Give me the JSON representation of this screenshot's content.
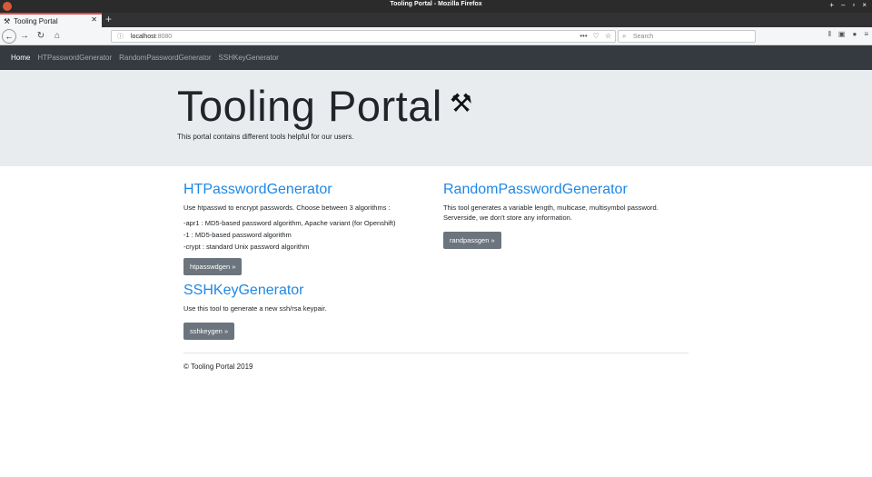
{
  "window": {
    "title": "Tooling Portal - Mozilla Firefox",
    "controls": [
      "+",
      "–",
      "▫",
      "×"
    ]
  },
  "browser": {
    "tab_title": "Tooling Portal",
    "url_host": "localhost",
    "url_port": ":8080",
    "search_placeholder": "Search"
  },
  "site": {
    "nav": [
      {
        "label": "Home",
        "active": true
      },
      {
        "label": "HTPasswordGenerator"
      },
      {
        "label": "RandomPasswordGenerator"
      },
      {
        "label": "SSHKeyGenerator"
      }
    ],
    "jumbotron": {
      "title": "Tooling Portal",
      "subtitle": "This portal contains different tools helpful for our users."
    },
    "ht": {
      "heading": "HTPasswordGenerator",
      "desc": "Use htpasswd to encrypt passwords. Choose between 3 algorithms :",
      "algorithms": [
        "-apr1 : MD5-based password algorithm, Apache variant (for Openshift)",
        "-1 : MD5-based password algorithm",
        "-crypt : standard Unix password algorithm"
      ],
      "button": "htpasswdgen »"
    },
    "random": {
      "heading": "RandomPasswordGenerator",
      "desc_line1": "This tool generates a variable length, multicase, multisymbol password.",
      "desc_line2": "Serverside, we don't store any information.",
      "button": "randpassgen »"
    },
    "ssh": {
      "heading": "SSHKeyGenerator",
      "desc": "Use this tool to generate a new ssh/rsa keypair.",
      "button": "sshkeygen »"
    },
    "footer": "© Tooling Portal 2019"
  }
}
